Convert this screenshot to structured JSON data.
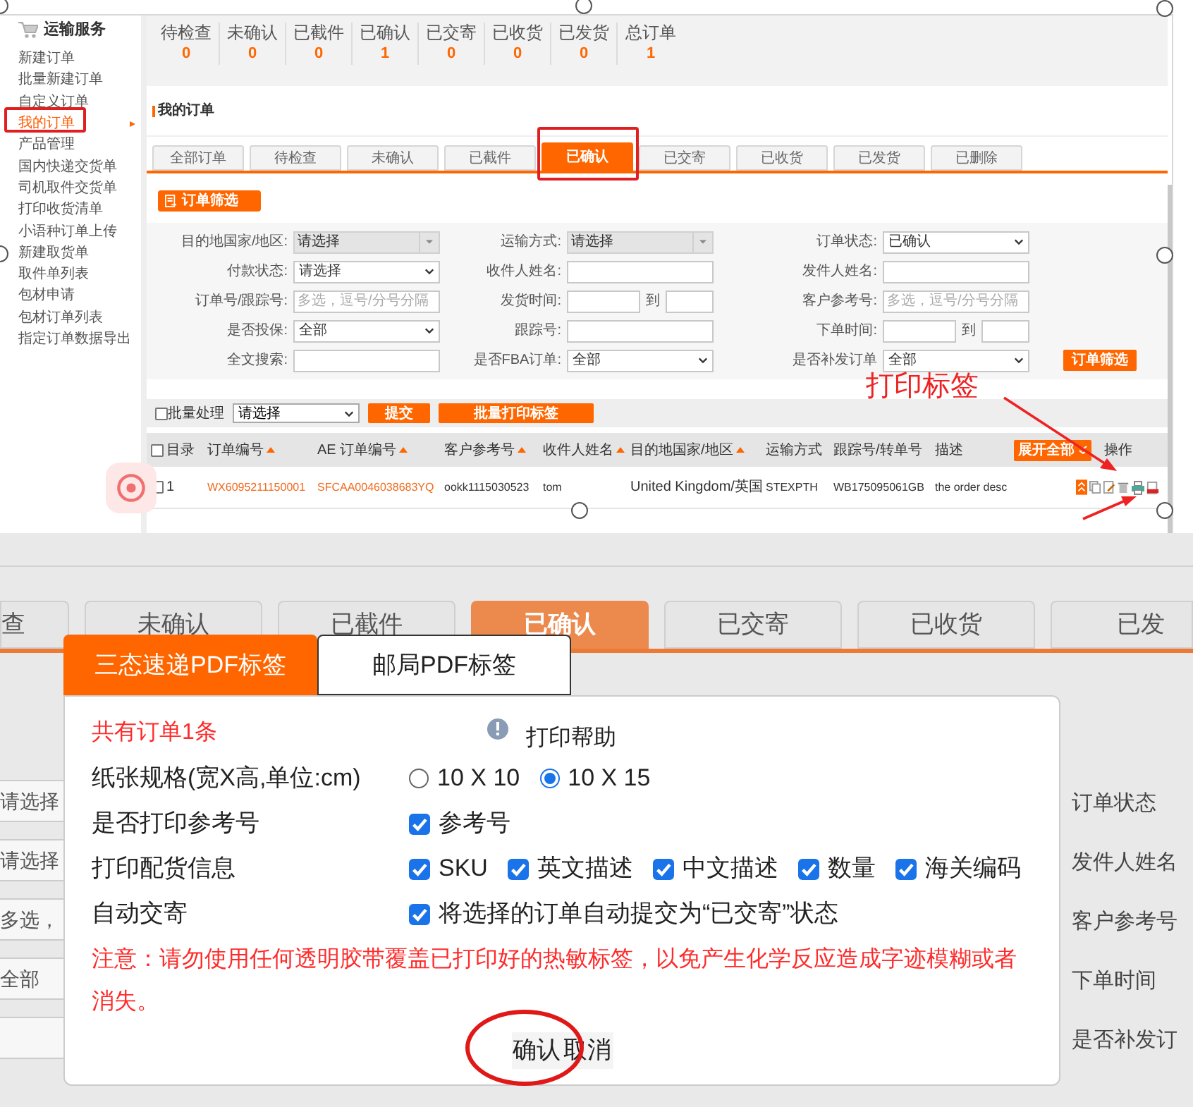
{
  "top_screenshot": {
    "sidebar": {
      "title": "运输服务",
      "items": [
        {
          "label": "新建订单",
          "selected": false
        },
        {
          "label": "批量新建订单",
          "selected": false
        },
        {
          "label": "自定义订单",
          "selected": false
        },
        {
          "label": "我的订单",
          "selected": true
        },
        {
          "label": "产品管理",
          "selected": false
        },
        {
          "label": "国内快递交货单",
          "selected": false
        },
        {
          "label": "司机取件交货单",
          "selected": false
        },
        {
          "label": "打印收货清单",
          "selected": false
        },
        {
          "label": "小语种订单上传",
          "selected": false
        },
        {
          "label": "新建取货单",
          "selected": false
        },
        {
          "label": "取件单列表",
          "selected": false
        },
        {
          "label": "包材申请",
          "selected": false
        },
        {
          "label": "包材订单列表",
          "selected": false
        },
        {
          "label": "指定订单数据导出",
          "selected": false
        }
      ]
    },
    "status_counts": [
      {
        "label": "待检查",
        "count": "0"
      },
      {
        "label": "未确认",
        "count": "0"
      },
      {
        "label": "已截件",
        "count": "0"
      },
      {
        "label": "已确认",
        "count": "1"
      },
      {
        "label": "已交寄",
        "count": "0"
      },
      {
        "label": "已收货",
        "count": "0"
      },
      {
        "label": "已发货",
        "count": "0"
      },
      {
        "label": "总订单",
        "count": "1"
      }
    ],
    "section_title": "我的订单",
    "tabs": [
      {
        "label": "全部订单",
        "selected": false
      },
      {
        "label": "待检查",
        "selected": false
      },
      {
        "label": "未确认",
        "selected": false
      },
      {
        "label": "已截件",
        "selected": false
      },
      {
        "label": "已确认",
        "selected": true
      },
      {
        "label": "已交寄",
        "selected": false
      },
      {
        "label": "已收货",
        "selected": false
      },
      {
        "label": "已发货",
        "selected": false
      },
      {
        "label": "已删除",
        "selected": false
      }
    ],
    "filter_toggle": "订单筛选",
    "filters": [
      {
        "label": "目的地国家/地区:",
        "kind": "combo",
        "value": "请选择"
      },
      {
        "label": "运输方式:",
        "kind": "combo",
        "value": "请选择"
      },
      {
        "label": "订单状态:",
        "kind": "select",
        "value": "已确认"
      },
      {
        "label": "付款状态:",
        "kind": "select",
        "value": "请选择"
      },
      {
        "label": "收件人姓名:",
        "kind": "input"
      },
      {
        "label": "发件人姓名:",
        "kind": "input"
      },
      {
        "label": "订单号/跟踪号:",
        "kind": "input",
        "placeholder": "多选，逗号/分号分隔"
      },
      {
        "label": "发货时间:",
        "kind": "range",
        "separator": "到"
      },
      {
        "label": "客户参考号:",
        "kind": "input",
        "placeholder": "多选，逗号/分号分隔"
      },
      {
        "label": "是否投保:",
        "kind": "select",
        "value": "全部"
      },
      {
        "label": "跟踪号:",
        "kind": "input"
      },
      {
        "label": "下单时间:",
        "kind": "range",
        "separator": "到"
      },
      {
        "label": "全文搜索:",
        "kind": "input"
      },
      {
        "label": "是否FBA订单:",
        "kind": "select",
        "value": "全部"
      },
      {
        "label": "是否补发订单",
        "kind": "select",
        "value": "全部"
      }
    ],
    "filter_submit": "订单筛选",
    "batch": {
      "checkbox_label": "批量处理",
      "checked": false,
      "select_value": "请选择",
      "buttons": [
        "提交",
        "批量打印标签"
      ]
    },
    "table": {
      "columns": [
        {
          "label": "目录",
          "kind": "checkbox",
          "checked": false
        },
        {
          "label": "订单编号",
          "kind": "sortable"
        },
        {
          "label": "AE 订单编号",
          "kind": "sortable"
        },
        {
          "label": "客户参考号",
          "kind": "sortable"
        },
        {
          "label": "收件人姓名",
          "kind": "sortable"
        },
        {
          "label": "目的地国家/地区",
          "kind": "sortable"
        },
        {
          "label": "运输方式",
          "kind": "plain"
        },
        {
          "label": "跟踪号/转单号",
          "kind": "plain"
        },
        {
          "label": "描述",
          "kind": "plain"
        },
        {
          "label": "展开全部",
          "kind": "button"
        },
        {
          "label": "操作",
          "kind": "plain"
        }
      ],
      "rows": [
        {
          "checked": false,
          "cells": [
            {
              "text": "1",
              "kind": "text"
            },
            {
              "text": "WX6095211150001",
              "kind": "link"
            },
            {
              "text": "SFCAA0046038683YQ",
              "kind": "link"
            },
            {
              "text": "ookk1115030523",
              "kind": "text"
            },
            {
              "text": "tom",
              "kind": "text"
            },
            {
              "text": "United Kingdom/英国",
              "kind": "text"
            },
            {
              "text": "STEXPTH",
              "kind": "text"
            },
            {
              "text": "WB175095061GB",
              "kind": "text"
            },
            {
              "text": "the order desc",
              "kind": "text"
            }
          ]
        }
      ]
    },
    "annotation": "打印标签"
  },
  "bottom_screenshot": {
    "tabs": [
      {
        "label": "查",
        "selected": false
      },
      {
        "label": "未确认",
        "selected": false
      },
      {
        "label": "已截件",
        "selected": false
      },
      {
        "label": "已确认",
        "selected": true
      },
      {
        "label": "已交寄",
        "selected": false
      },
      {
        "label": "已收货",
        "selected": false
      },
      {
        "label": "已发",
        "selected": false
      }
    ],
    "left_fields": [
      "请选择",
      "请选择",
      "多选，",
      "全部"
    ],
    "right_labels": [
      "订单状态",
      "发件人姓名",
      "客户参考号",
      "下单时间",
      "是否补发订"
    ],
    "dialog": {
      "tabs": [
        {
          "label": "三态速递PDF标签",
          "selected": true
        },
        {
          "label": "邮局PDF标签",
          "selected": false
        }
      ],
      "summary": "共有订单1条",
      "help": "打印帮助",
      "rows": [
        {
          "label": "纸张规格(宽X高,单位:cm)",
          "kind": "radio",
          "options": [
            {
              "label": "10 X 10",
              "selected": false
            },
            {
              "label": "10 X 15",
              "selected": true
            }
          ]
        },
        {
          "label": "是否打印参考号",
          "kind": "checkbox",
          "options": [
            {
              "label": "参考号",
              "checked": true
            }
          ]
        },
        {
          "label": "打印配货信息",
          "kind": "checkbox",
          "options": [
            {
              "label": "SKU",
              "checked": true
            },
            {
              "label": "英文描述",
              "checked": true
            },
            {
              "label": "中文描述",
              "checked": true
            },
            {
              "label": "数量",
              "checked": true
            },
            {
              "label": "海关编码",
              "checked": true
            }
          ]
        },
        {
          "label": "自动交寄",
          "kind": "checkbox",
          "options": [
            {
              "label": "将选择的订单自动提交为“已交寄”状态",
              "checked": true
            }
          ]
        }
      ],
      "warning": "注意：请勿使用任何透明胶带覆盖已打印好的热敏标签，以免产生化学反应造成字迹模糊或者消失。",
      "buttons": [
        "确认",
        "取消"
      ]
    }
  }
}
